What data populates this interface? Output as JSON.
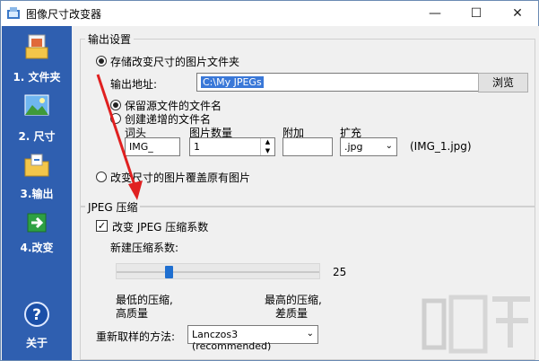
{
  "window": {
    "title": "图像尺寸改变器",
    "min": "—",
    "max": "☐",
    "close": "✕"
  },
  "sidebar": {
    "items": [
      {
        "label": "1. 文件夹",
        "icon": "folder-images-icon"
      },
      {
        "label": "2. 尺寸",
        "icon": "landscape-image-icon"
      },
      {
        "label": "3.输出",
        "icon": "output-folder-icon"
      },
      {
        "label": "4.改变",
        "icon": "green-arrow-icon"
      }
    ],
    "about": {
      "label": "关于",
      "icon": "help-icon"
    }
  },
  "output": {
    "group_title": "输出设置",
    "store_option": "存储改变尺寸的图片文件夹",
    "address_label": "输出地址:",
    "address_value": "C:\\My JPEGs",
    "browse": "浏览",
    "keep_names": "保留源文件的文件名",
    "create_names": "创建递增的文件名",
    "prefix_label": "词头",
    "prefix_value": "IMG_",
    "count_label": "图片数量",
    "count_value": "1",
    "append_label": "附加",
    "append_value": "",
    "ext_label": "扩充",
    "ext_value": ".jpg",
    "example": "(IMG_1.jpg)",
    "overwrite": "改变尺寸的图片覆盖原有图片"
  },
  "jpeg": {
    "group_title": "JPEG 压缩",
    "change_label": "改变 JPEG 压缩系数",
    "check_mark": "✓",
    "new_label": "新建压缩系数:",
    "value": "25",
    "level": 25,
    "min_label_1": "最低的压缩,",
    "min_label_2": "高质量",
    "max_label_1": "最高的压缩,",
    "max_label_2": "差质量"
  },
  "resample": {
    "label": "重新取样的方法:",
    "value": "Lanczos3 (recommended)"
  },
  "colors": {
    "sidebar": "#2f5fb0",
    "accent": "#1f6fd0",
    "arrow": "#e02020"
  }
}
